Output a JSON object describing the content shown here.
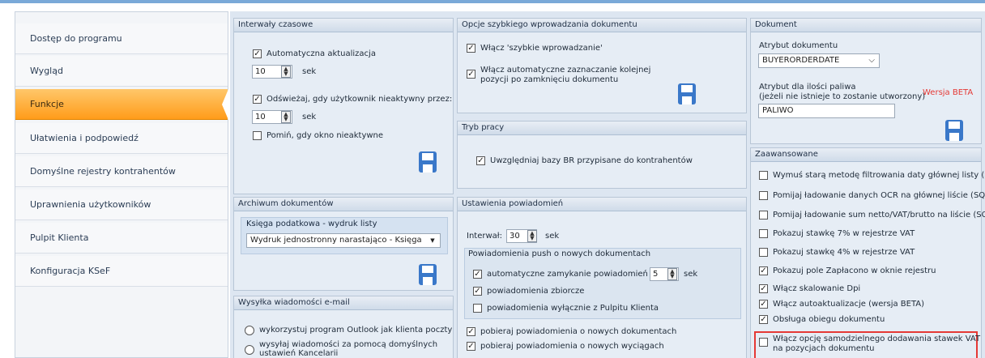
{
  "sidebar": {
    "items": [
      {
        "label": "Dostęp do programu"
      },
      {
        "label": "Wygląd"
      },
      {
        "label": "Funkcje"
      },
      {
        "label": "Ułatwienia i podpowiedź"
      },
      {
        "label": "Domyślne rejestry kontrahentów"
      },
      {
        "label": "Uprawnienia użytkowników"
      },
      {
        "label": "Pulpit Klienta"
      },
      {
        "label": "Konfiguracja KSeF"
      }
    ]
  },
  "interwaly": {
    "title": "Interwały czasowe",
    "auto_label": "Automatyczna aktualizacja",
    "auto_value": "10",
    "sek1": "sek",
    "odswiez_label": "Odświeżaj, gdy użytkownik nieaktywny przez:",
    "odswiez_value": "10",
    "sek2": "sek",
    "pomin_label": "Pomiń, gdy okno nieaktywne"
  },
  "opcje": {
    "title": "Opcje szybkiego wprowadzania dokumentu",
    "cb1": "Włącz 'szybkie wprowadzanie'",
    "cb2_line1": "Włącz automatyczne zaznaczanie kolejnej",
    "cb2_line2": "pozycji po zamknięciu dokumentu"
  },
  "tryb": {
    "title": "Tryb pracy",
    "cb1": "Uwzględniaj bazy BR przypisane do kontrahentów"
  },
  "dokument": {
    "title": "Dokument",
    "atrybut_label": "Atrybut dokumentu",
    "atrybut_value": "BUYERORDERDATE",
    "paliwo_label1": "Atrybut dla ilości paliwa",
    "paliwo_label2": "(jeżeli nie istnieje to zostanie utworzony)",
    "beta": "Wersja BETA",
    "paliwo_value": "PALIWO"
  },
  "zaawansowane": {
    "title": "Zaawansowane",
    "items": [
      {
        "label": "Wymuś starą metodę filtrowania daty głównej listy (SQL)",
        "checked": false
      },
      {
        "label": "Pomijaj ładowanie danych OCR na głównej liście (SQL)",
        "checked": false
      },
      {
        "label": "Pomijaj ładowanie sum netto/VAT/brutto na liście (SQL)",
        "checked": false
      },
      {
        "label": "Pokazuj stawkę 7% w rejestrze VAT",
        "checked": false
      },
      {
        "label": "Pokazuj stawkę 4% w rejestrze VAT",
        "checked": false
      },
      {
        "label": "Pokazuj pole Zapłacono w oknie rejestru",
        "checked": true
      },
      {
        "label": "Włącz skalowanie Dpi",
        "checked": true
      },
      {
        "label": "Włącz autoaktualizacje (wersja BETA)",
        "checked": true
      },
      {
        "label": "Obsługa obiegu dokumentu",
        "checked": true
      }
    ],
    "last_line1": "Włącz opcję samodzielnego dodawania stawek VAT",
    "last_line2": "na pozycjach dokumentu"
  },
  "archiwum": {
    "title": "Archiwum dokumentów",
    "subheader": "Księga podatkowa - wydruk listy",
    "select_value": "Wydruk jednostronny narastająco - Księga"
  },
  "wysylka": {
    "title": "Wysyłka wiadomości e-mail",
    "r1": "wykorzystuj program Outlook jak klienta poczty",
    "r2_line1": "wysyłaj wiadomości za pomocą domyślnych",
    "r2_line2": "ustawień Kancelarii"
  },
  "powiadomienia": {
    "title": "Ustawienia powiadomień",
    "interwal_label": "Interwał:",
    "interwal_value": "30",
    "sek": "sek",
    "push_header": "Powiadomienia push o nowych dokumentach",
    "push1": "automatyczne zamykanie powiadomień po:",
    "push1_value": "5",
    "push1_sek": "sek",
    "push2": "powiadomienia zbiorcze",
    "push3": "powiadomienia wyłącznie z Pulpitu Klienta",
    "cb_docs": "pobieraj powiadomienia o nowych dokumentach",
    "cb_wyciagi": "pobieraj powiadomienia o nowych wyciągach"
  }
}
